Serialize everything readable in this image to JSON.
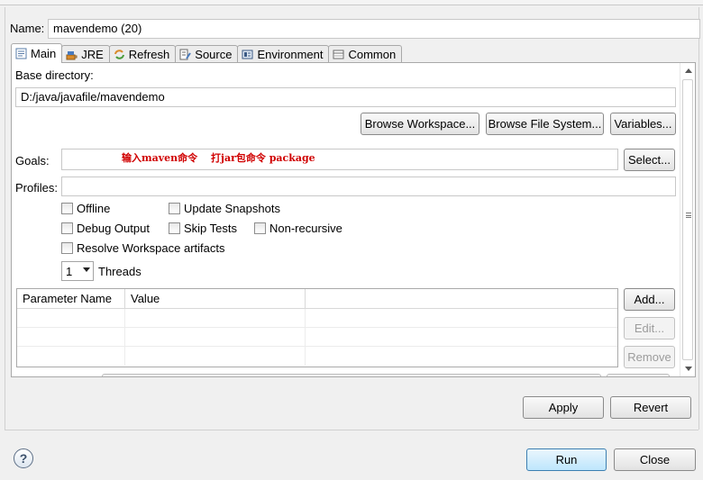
{
  "name": {
    "label": "Name:",
    "value": "mavendemo (20)"
  },
  "tabs": [
    {
      "label": "Main",
      "icon": "main-tab-icon",
      "active": true
    },
    {
      "label": "JRE",
      "icon": "jre-tab-icon",
      "active": false
    },
    {
      "label": "Refresh",
      "icon": "refresh-tab-icon",
      "active": false
    },
    {
      "label": "Source",
      "icon": "source-tab-icon",
      "active": false
    },
    {
      "label": "Environment",
      "icon": "environment-tab-icon",
      "active": false
    },
    {
      "label": "Common",
      "icon": "common-tab-icon",
      "active": false
    }
  ],
  "main": {
    "base_dir_label": "Base directory:",
    "base_dir_value": "D:/java/javafile/mavendemo",
    "browse_workspace": "Browse Workspace...",
    "browse_fs": "Browse File System...",
    "variables": "Variables...",
    "goals_label": "Goals:",
    "goals_value": "",
    "goals_note": "输入maven命令　 打jar包命令 package",
    "select": "Select...",
    "profiles_label": "Profiles:",
    "profiles_value": "",
    "checks": {
      "offline": {
        "label": "Offline",
        "checked": false
      },
      "update_snapshots": {
        "label": "Update Snapshots",
        "checked": false
      },
      "debug_output": {
        "label": "Debug Output",
        "checked": false
      },
      "skip_tests": {
        "label": "Skip Tests",
        "checked": false
      },
      "non_recursive": {
        "label": "Non-recursive",
        "checked": false
      },
      "resolve_workspace": {
        "label": "Resolve Workspace artifacts",
        "checked": false
      }
    },
    "threads_value": "1",
    "threads_label": "Threads",
    "table": {
      "headers": [
        "Parameter Name",
        "Value"
      ],
      "rows": []
    },
    "add": "Add...",
    "edit": "Edit...",
    "remove": "Remove"
  },
  "footer": {
    "apply": "Apply",
    "revert": "Revert",
    "run": "Run",
    "close": "Close",
    "help_icon": "help-icon"
  },
  "colors": {
    "note_red": "#d00000",
    "primary_border": "#3c7fb1"
  }
}
